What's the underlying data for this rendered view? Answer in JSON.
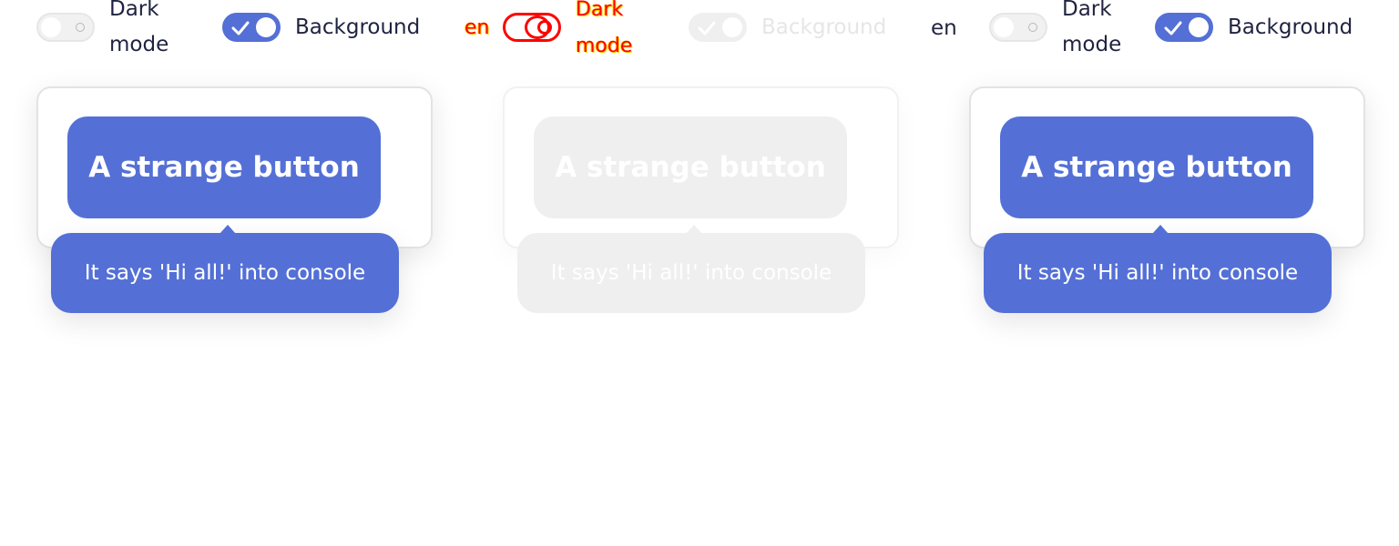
{
  "controls": {
    "dark_mode_line1": "Dark",
    "dark_mode_line2": "mode",
    "background_label": "Background",
    "language": "en",
    "dark_mode_on": false,
    "background_on": true
  },
  "card": {
    "button_label": "A strange button",
    "tooltip_text": "It says 'Hi all!' into console"
  },
  "colors": {
    "accent": "#5470d6",
    "toggle_off": "#f1f1f1",
    "text": "#1f2340",
    "faded": "#efefef",
    "overlay_red": "#ff0000"
  }
}
